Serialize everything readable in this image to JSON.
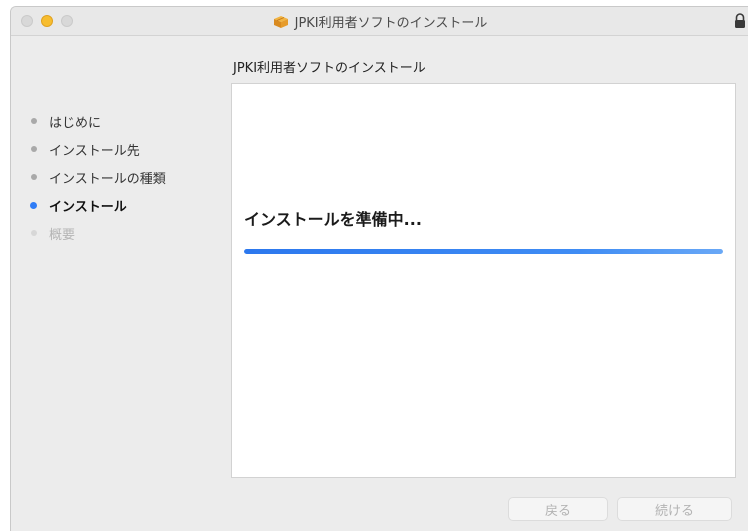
{
  "window": {
    "title": "JPKI利用者ソフトのインストール"
  },
  "header": {
    "title": "JPKI利用者ソフトのインストール"
  },
  "sidebar": {
    "steps": [
      {
        "label": "はじめに",
        "state": "done"
      },
      {
        "label": "インストール先",
        "state": "done"
      },
      {
        "label": "インストールの種類",
        "state": "done"
      },
      {
        "label": "インストール",
        "state": "active"
      },
      {
        "label": "概要",
        "state": "disabled"
      }
    ]
  },
  "main": {
    "status": "インストールを準備中...",
    "progress_percent": 100
  },
  "buttons": {
    "back_label": "戻る",
    "continue_label": "続ける"
  },
  "icons": {
    "package": "package-icon",
    "lock": "lock-icon"
  },
  "colors": {
    "accent": "#2f7cf6",
    "minimize_button": "#f7bd2f"
  }
}
